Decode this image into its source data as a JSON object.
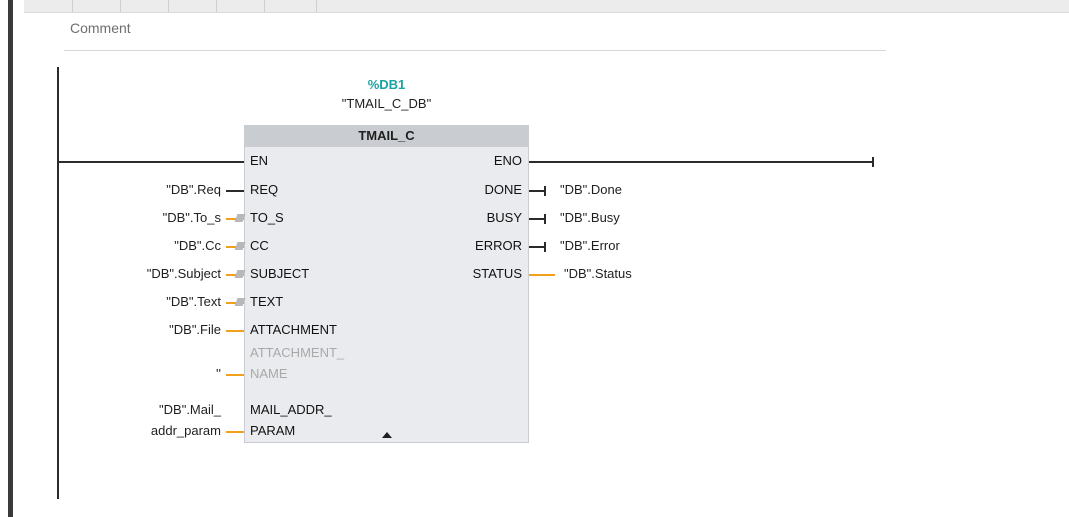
{
  "comment": {
    "label": "Comment"
  },
  "block": {
    "db_number": "%DB1",
    "db_name": "\"TMAIL_C_DB\"",
    "type": "TMAIL_C",
    "inputs": [
      {
        "pin": "EN",
        "operand": ""
      },
      {
        "pin": "REQ",
        "operand": "\"DB\".Req"
      },
      {
        "pin": "TO_S",
        "operand": "\"DB\".To_s"
      },
      {
        "pin": "CC",
        "operand": "\"DB\".Cc"
      },
      {
        "pin": "SUBJECT",
        "operand": "\"DB\".Subject"
      },
      {
        "pin": "TEXT",
        "operand": "\"DB\".Text"
      },
      {
        "pin": "ATTACHMENT",
        "operand": "\"DB\".File"
      },
      {
        "pin_line1": "ATTACHMENT_",
        "pin_line2": "NAME",
        "operand": "''"
      },
      {
        "pin_line1": "MAIL_ADDR_",
        "pin_line2": "PARAM",
        "operand_line1": "\"DB\".Mail_",
        "operand_line2": "addr_param"
      }
    ],
    "outputs": [
      {
        "pin": "ENO",
        "operand": ""
      },
      {
        "pin": "DONE",
        "operand": "\"DB\".Done"
      },
      {
        "pin": "BUSY",
        "operand": "\"DB\".Busy"
      },
      {
        "pin": "ERROR",
        "operand": "\"DB\".Error"
      },
      {
        "pin": "STATUS",
        "operand": "\"DB\".Status"
      }
    ]
  },
  "colors": {
    "db_number": "#1aa3a3",
    "block_body": "#e9ebee",
    "block_header": "#c9ccd1",
    "wire": "#2b2b2b",
    "orange_lead": "#f0a01c"
  },
  "icons": {
    "expand": "triangle-up-icon",
    "negation": "negation-marker-icon"
  }
}
